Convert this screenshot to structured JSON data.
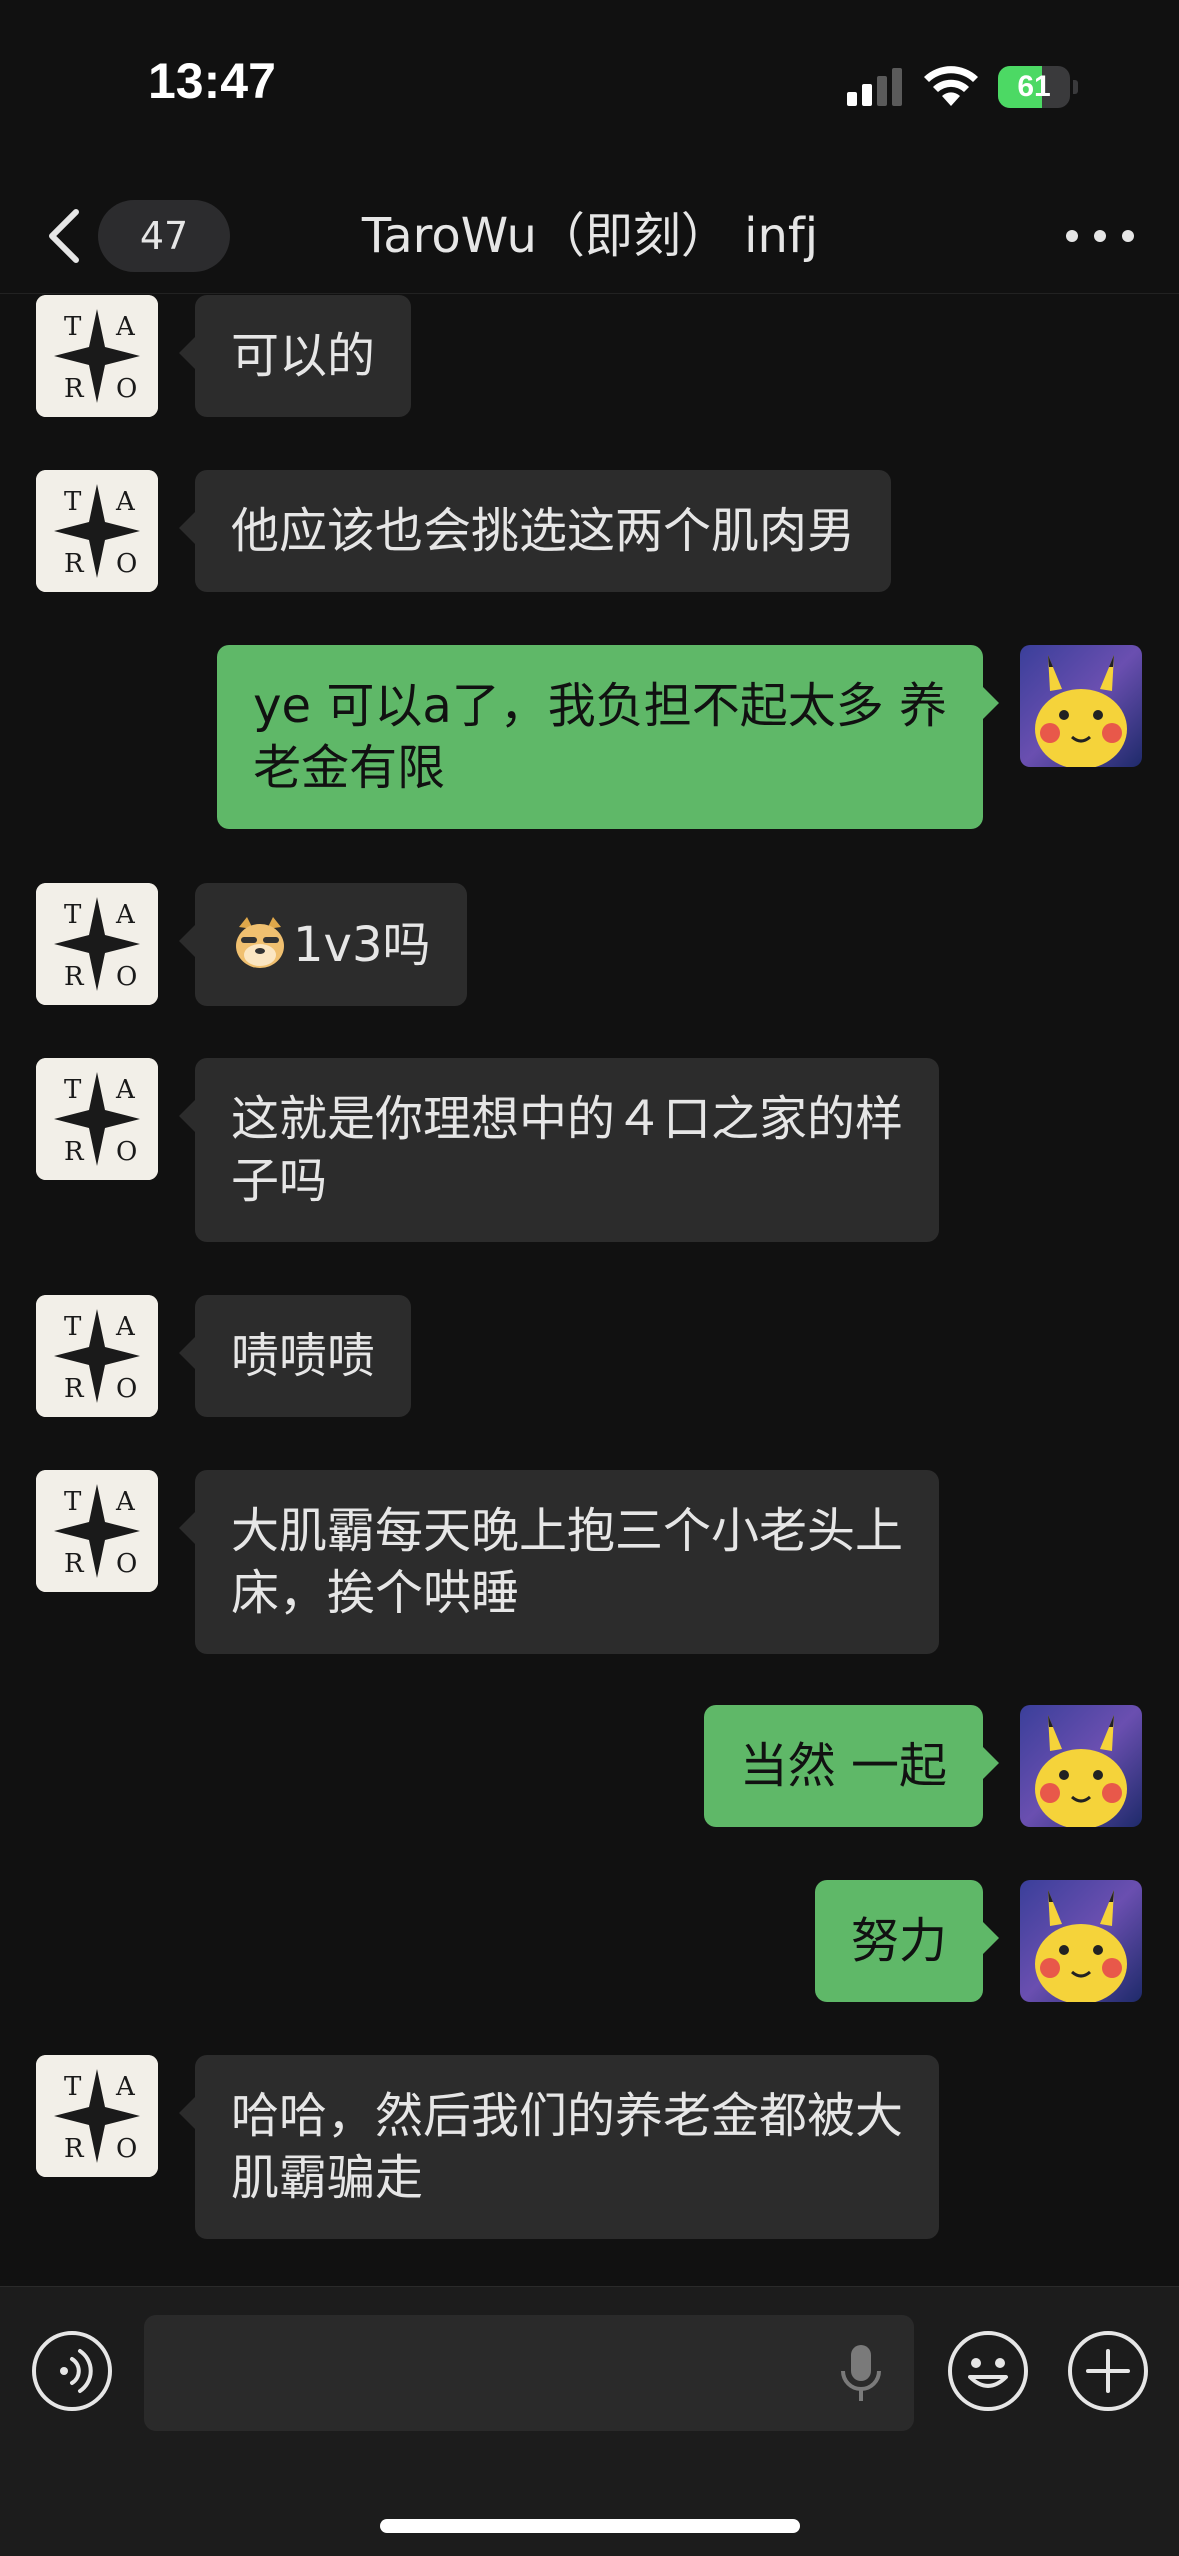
{
  "status_bar": {
    "time": "13:47",
    "battery_level": "61",
    "battery_fraction": 0.61,
    "battery_color": "#4cd964"
  },
  "nav": {
    "back_icon": "chevron-left-icon",
    "unread_count": "47",
    "title": "TaroWu（即刻） infj",
    "more_icon": "ellipsis-icon"
  },
  "messages": [
    {
      "side": "left",
      "text": "可以的"
    },
    {
      "side": "left",
      "text": "他应该也会挑选这两个肌肉男"
    },
    {
      "side": "right",
      "text": "ye 可以a了，我负担不起太多 养\n老金有限"
    },
    {
      "side": "left",
      "emoji": "doge-emoji",
      "text": "1v3吗"
    },
    {
      "side": "left",
      "text": "这就是你理想中的４口之家的样\n子吗"
    },
    {
      "side": "left",
      "text": "啧啧啧"
    },
    {
      "side": "left",
      "text": "大肌霸每天晚上抱三个小老头上\n床，挨个哄睡"
    },
    {
      "side": "right",
      "text": "当然 一起"
    },
    {
      "side": "right",
      "text": "努力"
    },
    {
      "side": "left",
      "text": "哈哈，然后我们的养老金都被大\n肌霸骗走"
    }
  ],
  "avatars": {
    "contact_letters": [
      "T",
      "A",
      "R",
      "O"
    ],
    "self": "pikachu-avatar"
  },
  "input_bar": {
    "voice_icon": "voice-mode-icon",
    "input_value": "",
    "mic_icon": "microphone-icon",
    "emoji_icon": "smiley-icon",
    "plus_icon": "plus-circle-icon"
  },
  "colors": {
    "background": "#111111",
    "incoming_bubble": "#2c2c2c",
    "outgoing_bubble": "#5fb868"
  }
}
